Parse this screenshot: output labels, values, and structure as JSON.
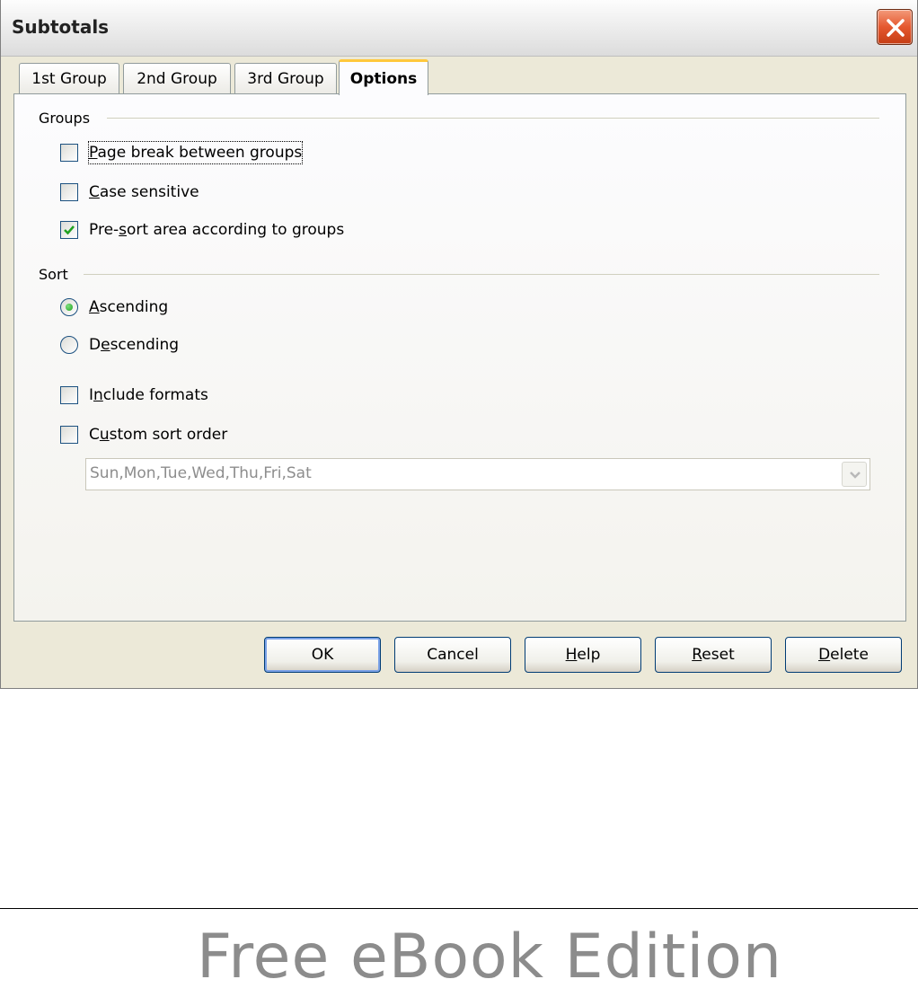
{
  "window": {
    "title": "Subtotals"
  },
  "tabs": [
    {
      "label": "1st Group",
      "active": false
    },
    {
      "label": "2nd Group",
      "active": false
    },
    {
      "label": "3rd Group",
      "active": false
    },
    {
      "label": "Options",
      "active": true
    }
  ],
  "groups": {
    "heading": "Groups",
    "options": [
      {
        "pre": "",
        "key": "P",
        "post": "age break between groups",
        "checked": false,
        "focused": true
      },
      {
        "pre": "",
        "key": "C",
        "post": "ase sensitive",
        "checked": false
      },
      {
        "pre": "Pre-",
        "key": "s",
        "post": "ort area according to groups",
        "checked": true
      }
    ]
  },
  "sort": {
    "heading": "Sort",
    "radios": [
      {
        "pre": "",
        "key": "A",
        "post": "scending",
        "selected": true
      },
      {
        "pre": "D",
        "key": "e",
        "post": "scending",
        "selected": false
      }
    ],
    "checks": [
      {
        "pre": "I",
        "key": "n",
        "post": "clude formats",
        "checked": false
      },
      {
        "pre": "C",
        "key": "u",
        "post": "stom sort order",
        "checked": false
      }
    ],
    "custom_sort_value": "Sun,Mon,Tue,Wed,Thu,Fri,Sat"
  },
  "buttons": [
    {
      "pre": "OK",
      "key": "",
      "post": "",
      "default": true
    },
    {
      "pre": "Cancel",
      "key": "",
      "post": ""
    },
    {
      "pre": "",
      "key": "H",
      "post": "elp"
    },
    {
      "pre": "",
      "key": "R",
      "post": "eset"
    },
    {
      "pre": "",
      "key": "D",
      "post": "elete"
    }
  ],
  "footer": {
    "text": "Free eBook Edition"
  },
  "colors": {
    "window_bg": "#ece9d8",
    "close_button": "#e5582f",
    "active_tab_accent": "#ffc83c",
    "check_mark": "#21a121",
    "button_border": "#003c74"
  },
  "icons": {
    "close": "close-x-icon",
    "combo_arrow": "chevron-down-icon",
    "check": "check-mark-icon"
  }
}
